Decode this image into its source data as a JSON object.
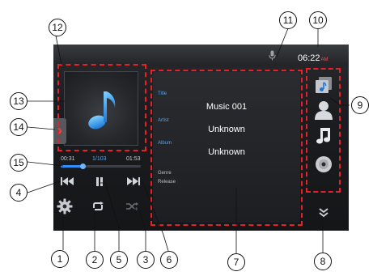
{
  "status": {
    "clock_time": "06:22",
    "clock_ampm": "AM"
  },
  "player": {
    "elapsed": "00:31",
    "track_index": "1/103",
    "duration": "01:53",
    "progress": 0.274
  },
  "info": {
    "title_label": "Title",
    "title_value": "Music 001",
    "artist_label": "Artist",
    "artist_value": "Unknown",
    "album_label": "Album",
    "album_value": "Unknown",
    "genre_label": "Genre",
    "release_label": "Release"
  },
  "callouts": [
    "1",
    "2",
    "3",
    "4",
    "5",
    "6",
    "7",
    "8",
    "9",
    "10",
    "11",
    "12",
    "13",
    "14",
    "15"
  ],
  "colors": {
    "accent": "#2f8fff",
    "highlight": "#e8202a"
  }
}
